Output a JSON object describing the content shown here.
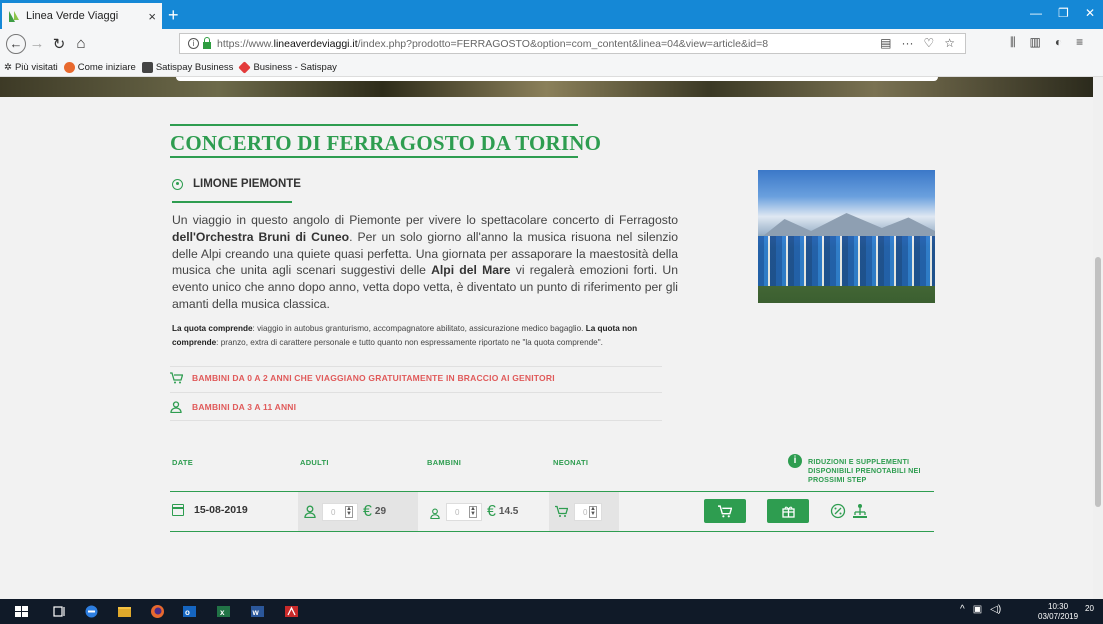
{
  "browser": {
    "tab_title": "Linea Verde Viaggi",
    "tab_close": "×",
    "new_tab": "+",
    "url_prefix": "https://www.",
    "url_host": "lineaverdeviaggi.it",
    "url_path": "/index.php?prodotto=FERRAGOSTO&option=com_content&linea=04&view=article&id=8",
    "bookmarks": [
      "Più visitati",
      "Come iniziare",
      "Satispay Business",
      "Business - Satispay"
    ]
  },
  "colors": {
    "brand_green": "#2e9d50",
    "accent_red": "#e05a5a",
    "tab_bar_blue": "#1588d6"
  },
  "page": {
    "title": "CONCERTO DI FERRAGOSTO DA TORINO",
    "location": "LIMONE PIEMONTE",
    "desc_1": "Un viaggio in questo angolo di Piemonte per vivere lo spettacolare concerto di Ferragosto ",
    "desc_b1": "dell'Orchestra Bruni di Cuneo",
    "desc_2": ". Per un solo giorno all'anno la musica risuona nel silenzio delle Alpi creando una quiete quasi perfetta. Una giornata per assaporare la maestosità della musica che unita agli scenari suggestivi delle ",
    "desc_b2": "Alpi del Mare",
    "desc_3": " vi regalerà emozioni forti. Un evento unico che anno dopo anno, vetta dopo vetta, è diventato un punto di riferimento per gli amanti della musica classica.",
    "quota_b1": "La quota comprende",
    "quota_1": ": viaggio in autobus granturismo, accompagnatore abilitato, assicurazione medico bagaglio. ",
    "quota_b2": "La quota non comprende",
    "quota_2": ": pranzo, extra di carattere personale e tutto quanto non espressamente riportato ne \"la quota comprende\".",
    "child_0_2": "BAMBINI DA 0 A 2 ANNI CHE VIAGGIANO GRATUITAMENTE IN BRACCIO AI GENITORI",
    "child_3_11": "BAMBINI DA 3 A 11 ANNI"
  },
  "booking": {
    "headers": {
      "date": "DATE",
      "adults": "ADULTI",
      "children": "BAMBINI",
      "infants": "NEONATI"
    },
    "info_badge": "i",
    "reductions": "RIDUZIONI E SUPPLEMENTI DISPONIBILI PRENOTABILI NEI PROSSIMI STEP",
    "row": {
      "date": "15-08-2019",
      "adult_price": "29",
      "child_price": "14.5",
      "currency": "€",
      "adult_qty_placeholder": "0",
      "child_qty_placeholder": "0",
      "infant_qty_placeholder": "0"
    }
  },
  "taskbar": {
    "time": "10:30",
    "date": "03/07/2019",
    "notifications": "20"
  }
}
